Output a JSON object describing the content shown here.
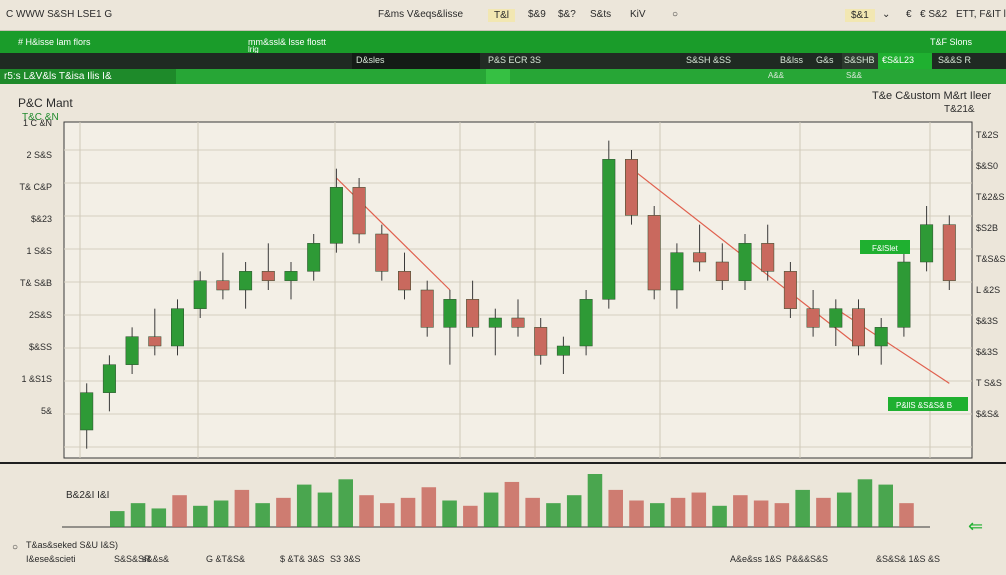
{
  "topbar": {
    "left_title": "C WWW S&SH LSE1 G",
    "center_1": "F&ms V&eqs&lisse",
    "chip_1": "T&l",
    "chip_2": "$&9",
    "chip_3": "$&?",
    "chip_4": "S&ts",
    "chip_5": "KiV",
    "right_chip": "$&1",
    "right_1": "€",
    "right_2": "€ S&2",
    "right_3": "ETT, F&IT lliegt"
  },
  "greenbar": {
    "item_1": "#  H&isse lam flors",
    "item_2": "mm&ssl& lsse flostt",
    "item_3": "lrig",
    "right_item": "T&F Slons"
  },
  "darkbar": {
    "item_1": "D&sles",
    "item_2": "P&S ECR 3S",
    "item_3": "S&SH &SS",
    "item_4": "B&lss",
    "item_5": "G&s",
    "item_6": "S&SHB",
    "item_7": "€S&L23",
    "item_8": "S&&S R",
    "sub_1": "A&&",
    "sub_2": "S&&"
  },
  "bluebar": {
    "tab_label": "r5:s L&V&ls T&isa Ilis I&"
  },
  "chart_header": {
    "left_title": "P&C Mant",
    "left_sub": "T&C &N",
    "right_title": "T&e C&ustom M&rt Ileer",
    "right_sub": "T&21&"
  },
  "colors": {
    "up": "#2e9a36",
    "down": "#c9695e",
    "trend": "#e0604e",
    "accent_green": "#1fb030"
  },
  "left_axis": [
    "1 C &N",
    "2 S&S",
    "T& C&P",
    "$&23",
    "1 S&S",
    "T& S&B",
    "2S&S",
    "$&SS",
    "1 &S1S",
    "5&"
  ],
  "right_axis": [
    "T&2S",
    "$&S0",
    "T&2&S",
    "$S2B",
    "T&S&S",
    "L &2S",
    "$&3S",
    "$&3S",
    "T S&S",
    "$&S&"
  ],
  "callouts": {
    "upper": "F&lSlet",
    "lower": "P&llS &S&S& B"
  },
  "volume_label": "B&2&I I&I",
  "footer": {
    "left_1": "T&as&seked S&U I&S)",
    "left_2": "I&ese&scieti",
    "left_3": "S&S&SR",
    "left_4": "s&&s&",
    "left_5": "G &T&S&",
    "left_6": "$ &T& 3&S",
    "left_7": "S3 3&S",
    "right_1": "A&e&ss 1&S",
    "right_2": "P&&&S&S",
    "right_3": "&S&S& 1&S &S"
  },
  "chart_data": {
    "type": "candlestick",
    "candles": [
      {
        "x": 1,
        "o": 3,
        "h": 8,
        "l": 1,
        "c": 7
      },
      {
        "x": 2,
        "o": 7,
        "h": 11,
        "l": 5,
        "c": 10
      },
      {
        "x": 3,
        "o": 10,
        "h": 14,
        "l": 9,
        "c": 13
      },
      {
        "x": 4,
        "o": 13,
        "h": 16,
        "l": 11,
        "c": 12
      },
      {
        "x": 5,
        "o": 12,
        "h": 17,
        "l": 11,
        "c": 16
      },
      {
        "x": 6,
        "o": 16,
        "h": 20,
        "l": 15,
        "c": 19
      },
      {
        "x": 7,
        "o": 19,
        "h": 22,
        "l": 17,
        "c": 18
      },
      {
        "x": 8,
        "o": 18,
        "h": 21,
        "l": 16,
        "c": 20
      },
      {
        "x": 9,
        "o": 20,
        "h": 23,
        "l": 18,
        "c": 19
      },
      {
        "x": 10,
        "o": 19,
        "h": 21,
        "l": 17,
        "c": 20
      },
      {
        "x": 11,
        "o": 20,
        "h": 24,
        "l": 19,
        "c": 23
      },
      {
        "x": 12,
        "o": 23,
        "h": 31,
        "l": 22,
        "c": 29
      },
      {
        "x": 13,
        "o": 29,
        "h": 30,
        "l": 23,
        "c": 24
      },
      {
        "x": 14,
        "o": 24,
        "h": 25,
        "l": 19,
        "c": 20
      },
      {
        "x": 15,
        "o": 20,
        "h": 22,
        "l": 17,
        "c": 18
      },
      {
        "x": 16,
        "o": 18,
        "h": 19,
        "l": 13,
        "c": 14
      },
      {
        "x": 17,
        "o": 14,
        "h": 18,
        "l": 10,
        "c": 17
      },
      {
        "x": 18,
        "o": 17,
        "h": 19,
        "l": 13,
        "c": 14
      },
      {
        "x": 19,
        "o": 14,
        "h": 16,
        "l": 11,
        "c": 15
      },
      {
        "x": 20,
        "o": 15,
        "h": 17,
        "l": 13,
        "c": 14
      },
      {
        "x": 21,
        "o": 14,
        "h": 15,
        "l": 10,
        "c": 11
      },
      {
        "x": 22,
        "o": 11,
        "h": 13,
        "l": 9,
        "c": 12
      },
      {
        "x": 23,
        "o": 12,
        "h": 18,
        "l": 11,
        "c": 17
      },
      {
        "x": 24,
        "o": 17,
        "h": 34,
        "l": 16,
        "c": 32
      },
      {
        "x": 25,
        "o": 32,
        "h": 33,
        "l": 25,
        "c": 26
      },
      {
        "x": 26,
        "o": 26,
        "h": 27,
        "l": 17,
        "c": 18
      },
      {
        "x": 27,
        "o": 18,
        "h": 23,
        "l": 16,
        "c": 22
      },
      {
        "x": 28,
        "o": 22,
        "h": 25,
        "l": 20,
        "c": 21
      },
      {
        "x": 29,
        "o": 21,
        "h": 23,
        "l": 18,
        "c": 19
      },
      {
        "x": 30,
        "o": 19,
        "h": 24,
        "l": 18,
        "c": 23
      },
      {
        "x": 31,
        "o": 23,
        "h": 25,
        "l": 19,
        "c": 20
      },
      {
        "x": 32,
        "o": 20,
        "h": 21,
        "l": 15,
        "c": 16
      },
      {
        "x": 33,
        "o": 16,
        "h": 18,
        "l": 13,
        "c": 14
      },
      {
        "x": 34,
        "o": 14,
        "h": 17,
        "l": 12,
        "c": 16
      },
      {
        "x": 35,
        "o": 16,
        "h": 17,
        "l": 11,
        "c": 12
      },
      {
        "x": 36,
        "o": 12,
        "h": 15,
        "l": 10,
        "c": 14
      },
      {
        "x": 37,
        "o": 14,
        "h": 22,
        "l": 13,
        "c": 21
      },
      {
        "x": 38,
        "o": 21,
        "h": 27,
        "l": 20,
        "c": 25
      },
      {
        "x": 39,
        "o": 25,
        "h": 26,
        "l": 18,
        "c": 19
      }
    ],
    "volume": [
      6,
      9,
      7,
      12,
      8,
      10,
      14,
      9,
      11,
      16,
      13,
      18,
      12,
      9,
      11,
      15,
      10,
      8,
      13,
      17,
      11,
      9,
      12,
      20,
      14,
      10,
      9,
      11,
      13,
      8,
      12,
      10,
      9,
      14,
      11,
      13,
      18,
      16,
      9
    ],
    "trendlines": [
      {
        "from_x": 12,
        "from_y": 30,
        "to_x": 17,
        "to_y": 18
      },
      {
        "from_x": 25,
        "from_y": 31,
        "to_x": 35,
        "to_y": 12
      },
      {
        "from_x": 34,
        "from_y": 16,
        "to_x": 39,
        "to_y": 8
      }
    ],
    "ylim": [
      0,
      36
    ],
    "xlim": [
      0,
      40
    ],
    "grid": true
  }
}
